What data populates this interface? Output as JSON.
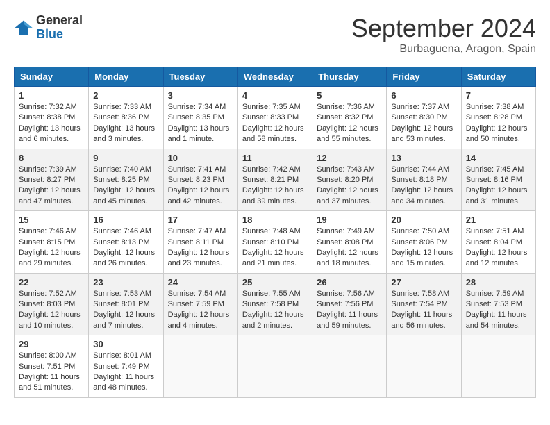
{
  "logo": {
    "general": "General",
    "blue": "Blue"
  },
  "title": "September 2024",
  "location": "Burbaguena, Aragon, Spain",
  "headers": [
    "Sunday",
    "Monday",
    "Tuesday",
    "Wednesday",
    "Thursday",
    "Friday",
    "Saturday"
  ],
  "weeks": [
    [
      {
        "day": "1",
        "info": "Sunrise: 7:32 AM\nSunset: 8:38 PM\nDaylight: 13 hours\nand 6 minutes."
      },
      {
        "day": "2",
        "info": "Sunrise: 7:33 AM\nSunset: 8:36 PM\nDaylight: 13 hours\nand 3 minutes."
      },
      {
        "day": "3",
        "info": "Sunrise: 7:34 AM\nSunset: 8:35 PM\nDaylight: 13 hours\nand 1 minute."
      },
      {
        "day": "4",
        "info": "Sunrise: 7:35 AM\nSunset: 8:33 PM\nDaylight: 12 hours\nand 58 minutes."
      },
      {
        "day": "5",
        "info": "Sunrise: 7:36 AM\nSunset: 8:32 PM\nDaylight: 12 hours\nand 55 minutes."
      },
      {
        "day": "6",
        "info": "Sunrise: 7:37 AM\nSunset: 8:30 PM\nDaylight: 12 hours\nand 53 minutes."
      },
      {
        "day": "7",
        "info": "Sunrise: 7:38 AM\nSunset: 8:28 PM\nDaylight: 12 hours\nand 50 minutes."
      }
    ],
    [
      {
        "day": "8",
        "info": "Sunrise: 7:39 AM\nSunset: 8:27 PM\nDaylight: 12 hours\nand 47 minutes."
      },
      {
        "day": "9",
        "info": "Sunrise: 7:40 AM\nSunset: 8:25 PM\nDaylight: 12 hours\nand 45 minutes."
      },
      {
        "day": "10",
        "info": "Sunrise: 7:41 AM\nSunset: 8:23 PM\nDaylight: 12 hours\nand 42 minutes."
      },
      {
        "day": "11",
        "info": "Sunrise: 7:42 AM\nSunset: 8:21 PM\nDaylight: 12 hours\nand 39 minutes."
      },
      {
        "day": "12",
        "info": "Sunrise: 7:43 AM\nSunset: 8:20 PM\nDaylight: 12 hours\nand 37 minutes."
      },
      {
        "day": "13",
        "info": "Sunrise: 7:44 AM\nSunset: 8:18 PM\nDaylight: 12 hours\nand 34 minutes."
      },
      {
        "day": "14",
        "info": "Sunrise: 7:45 AM\nSunset: 8:16 PM\nDaylight: 12 hours\nand 31 minutes."
      }
    ],
    [
      {
        "day": "15",
        "info": "Sunrise: 7:46 AM\nSunset: 8:15 PM\nDaylight: 12 hours\nand 29 minutes."
      },
      {
        "day": "16",
        "info": "Sunrise: 7:46 AM\nSunset: 8:13 PM\nDaylight: 12 hours\nand 26 minutes."
      },
      {
        "day": "17",
        "info": "Sunrise: 7:47 AM\nSunset: 8:11 PM\nDaylight: 12 hours\nand 23 minutes."
      },
      {
        "day": "18",
        "info": "Sunrise: 7:48 AM\nSunset: 8:10 PM\nDaylight: 12 hours\nand 21 minutes."
      },
      {
        "day": "19",
        "info": "Sunrise: 7:49 AM\nSunset: 8:08 PM\nDaylight: 12 hours\nand 18 minutes."
      },
      {
        "day": "20",
        "info": "Sunrise: 7:50 AM\nSunset: 8:06 PM\nDaylight: 12 hours\nand 15 minutes."
      },
      {
        "day": "21",
        "info": "Sunrise: 7:51 AM\nSunset: 8:04 PM\nDaylight: 12 hours\nand 12 minutes."
      }
    ],
    [
      {
        "day": "22",
        "info": "Sunrise: 7:52 AM\nSunset: 8:03 PM\nDaylight: 12 hours\nand 10 minutes."
      },
      {
        "day": "23",
        "info": "Sunrise: 7:53 AM\nSunset: 8:01 PM\nDaylight: 12 hours\nand 7 minutes."
      },
      {
        "day": "24",
        "info": "Sunrise: 7:54 AM\nSunset: 7:59 PM\nDaylight: 12 hours\nand 4 minutes."
      },
      {
        "day": "25",
        "info": "Sunrise: 7:55 AM\nSunset: 7:58 PM\nDaylight: 12 hours\nand 2 minutes."
      },
      {
        "day": "26",
        "info": "Sunrise: 7:56 AM\nSunset: 7:56 PM\nDaylight: 11 hours\nand 59 minutes."
      },
      {
        "day": "27",
        "info": "Sunrise: 7:58 AM\nSunset: 7:54 PM\nDaylight: 11 hours\nand 56 minutes."
      },
      {
        "day": "28",
        "info": "Sunrise: 7:59 AM\nSunset: 7:53 PM\nDaylight: 11 hours\nand 54 minutes."
      }
    ],
    [
      {
        "day": "29",
        "info": "Sunrise: 8:00 AM\nSunset: 7:51 PM\nDaylight: 11 hours\nand 51 minutes."
      },
      {
        "day": "30",
        "info": "Sunrise: 8:01 AM\nSunset: 7:49 PM\nDaylight: 11 hours\nand 48 minutes."
      },
      {
        "day": "",
        "info": ""
      },
      {
        "day": "",
        "info": ""
      },
      {
        "day": "",
        "info": ""
      },
      {
        "day": "",
        "info": ""
      },
      {
        "day": "",
        "info": ""
      }
    ]
  ]
}
